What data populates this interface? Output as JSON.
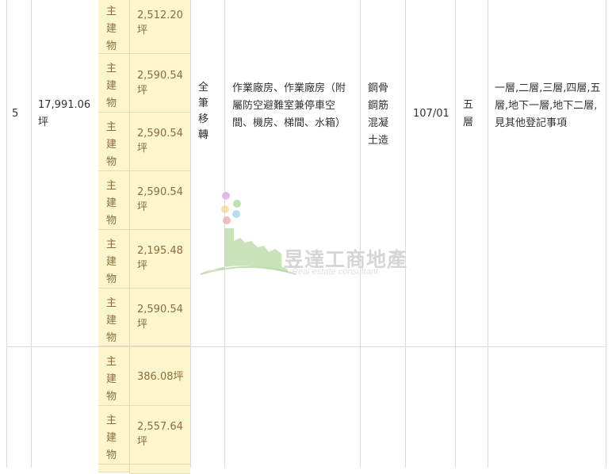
{
  "row5": {
    "index": "5",
    "total_area": "17,991.06坪",
    "transfer": "全筆移轉",
    "usage": "作業廠房、作業廠房（附屬防空避難室兼停車空間、機房、梯間、水箱）",
    "structure": "鋼骨鋼筋混凝土造",
    "completed": "107/01",
    "floors": "五層",
    "floor_desc": "一層,二層,三層,四層,五層,地下一層,地下二層,見其他登記事項",
    "items": [
      {
        "type": "主建物",
        "area": "2,512.20坪"
      },
      {
        "type": "主建物",
        "area": "2,590.54坪"
      },
      {
        "type": "主建物",
        "area": "2,590.54坪"
      },
      {
        "type": "主建物",
        "area": "2,590.54坪"
      },
      {
        "type": "主建物",
        "area": "2,195.48坪"
      },
      {
        "type": "主建物",
        "area": "2,590.54坪"
      }
    ]
  },
  "row6": {
    "items": [
      {
        "type": "主建物",
        "area": "386.08坪"
      },
      {
        "type": "主建物",
        "area": "2,557.64坪"
      }
    ]
  },
  "watermark": {
    "title": "昱達工商地產",
    "subtitle": "Real estate consultant"
  }
}
